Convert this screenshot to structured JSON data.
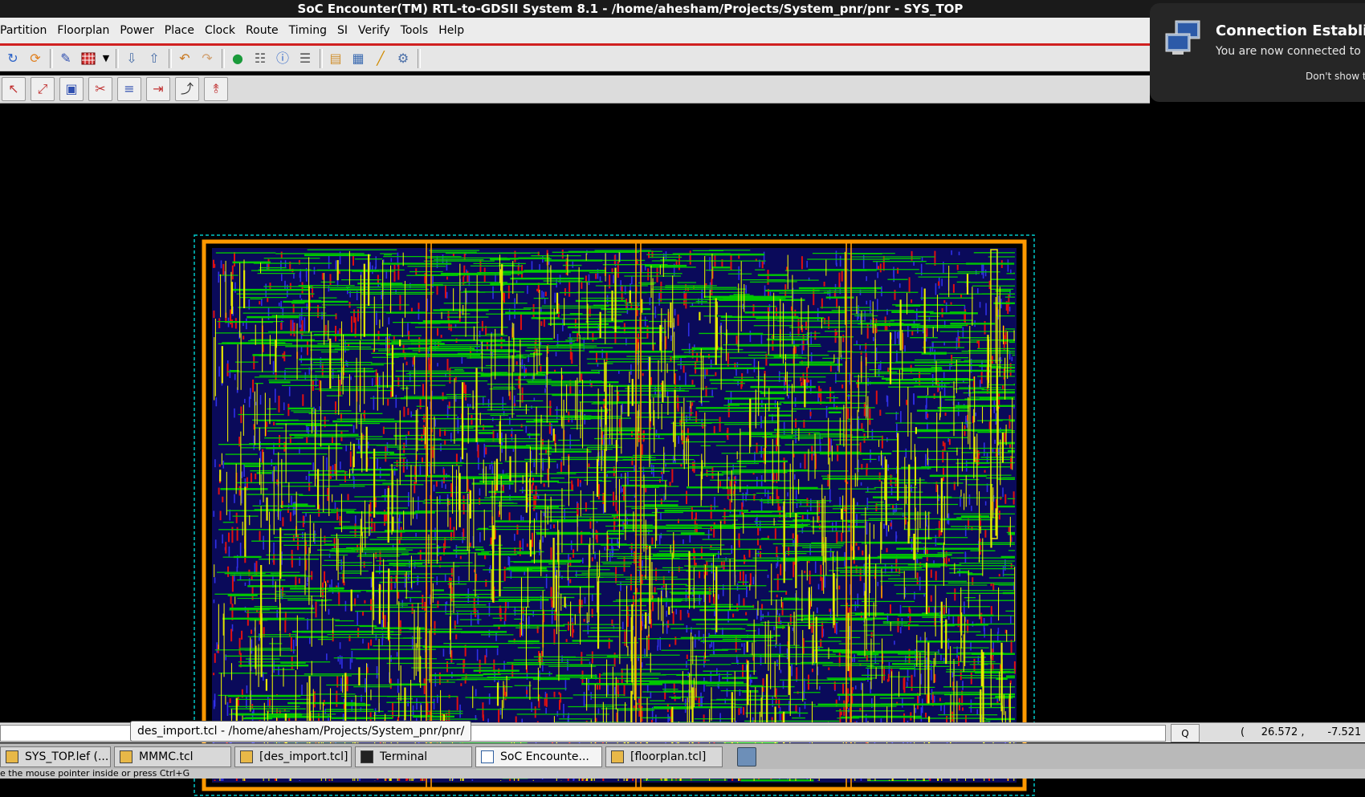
{
  "window": {
    "title": "SoC Encounter(TM) RTL-to-GDSII System 8.1 - /home/ahesham/Projects/System_pnr/pnr - SYS_TOP"
  },
  "menu": [
    {
      "label": "Partition"
    },
    {
      "label": "Floorplan"
    },
    {
      "label": "Power"
    },
    {
      "label": "Place"
    },
    {
      "label": "Clock"
    },
    {
      "label": "Route"
    },
    {
      "label": "Timing"
    },
    {
      "label": "SI"
    },
    {
      "label": "Verify"
    },
    {
      "label": "Tools"
    },
    {
      "label": "Help"
    }
  ],
  "toolbar_icons": [
    "redo-circle-icon",
    "refresh-icon",
    "draw-tool-icon",
    "fill-pattern-icon",
    "dropdown-arrow-icon",
    "push-down-icon",
    "pop-up-icon",
    "undo-icon",
    "redo-icon",
    "globe-icon",
    "hierarchy-icon",
    "info-icon",
    "notes-icon",
    "open-folder-icon",
    "layout-window-icon",
    "ruler-icon",
    "attribute-editor-icon"
  ],
  "edit_toolbar_icons": [
    "select-icon",
    "move-icon",
    "resize-icon",
    "cut-icon",
    "align-icon",
    "shift-icon",
    "snap-icon",
    "edit-route-icon"
  ],
  "notification": {
    "title": "Connection Establis",
    "body": "You are now connected to \"",
    "link": "Don't show t",
    "icon": "network-computers-icon"
  },
  "design": {
    "name": "SYS_TOP",
    "layer_colors": {
      "background": "#0a0a5a",
      "metal_h": "#00c800",
      "metal_v": "#e8e800",
      "metal_red": "#e01010",
      "metal_blue": "#3030e8",
      "power_ring": "#ff9900",
      "boundary": "#00c8c8"
    }
  },
  "status": {
    "tooltip": "des_import.tcl - /home/ahesham/Projects/System_pnr/pnr/",
    "q_button": "Q",
    "coordinates": "(     26.572 ,       -7.521 )"
  },
  "taskbar": [
    {
      "label": "SYS_TOP.lef (...",
      "icon": "text-editor-icon"
    },
    {
      "label": "MMMC.tcl",
      "icon": "text-editor-icon"
    },
    {
      "label": "[des_import.tcl]",
      "icon": "text-editor-icon"
    },
    {
      "label": "Terminal",
      "icon": "terminal-icon"
    },
    {
      "label": "SoC Encounte...",
      "icon": "app-window-icon"
    },
    {
      "label": "[floorplan.tcl]",
      "icon": "text-editor-icon"
    }
  ],
  "hint": "e the mouse pointer inside or press Ctrl+G"
}
